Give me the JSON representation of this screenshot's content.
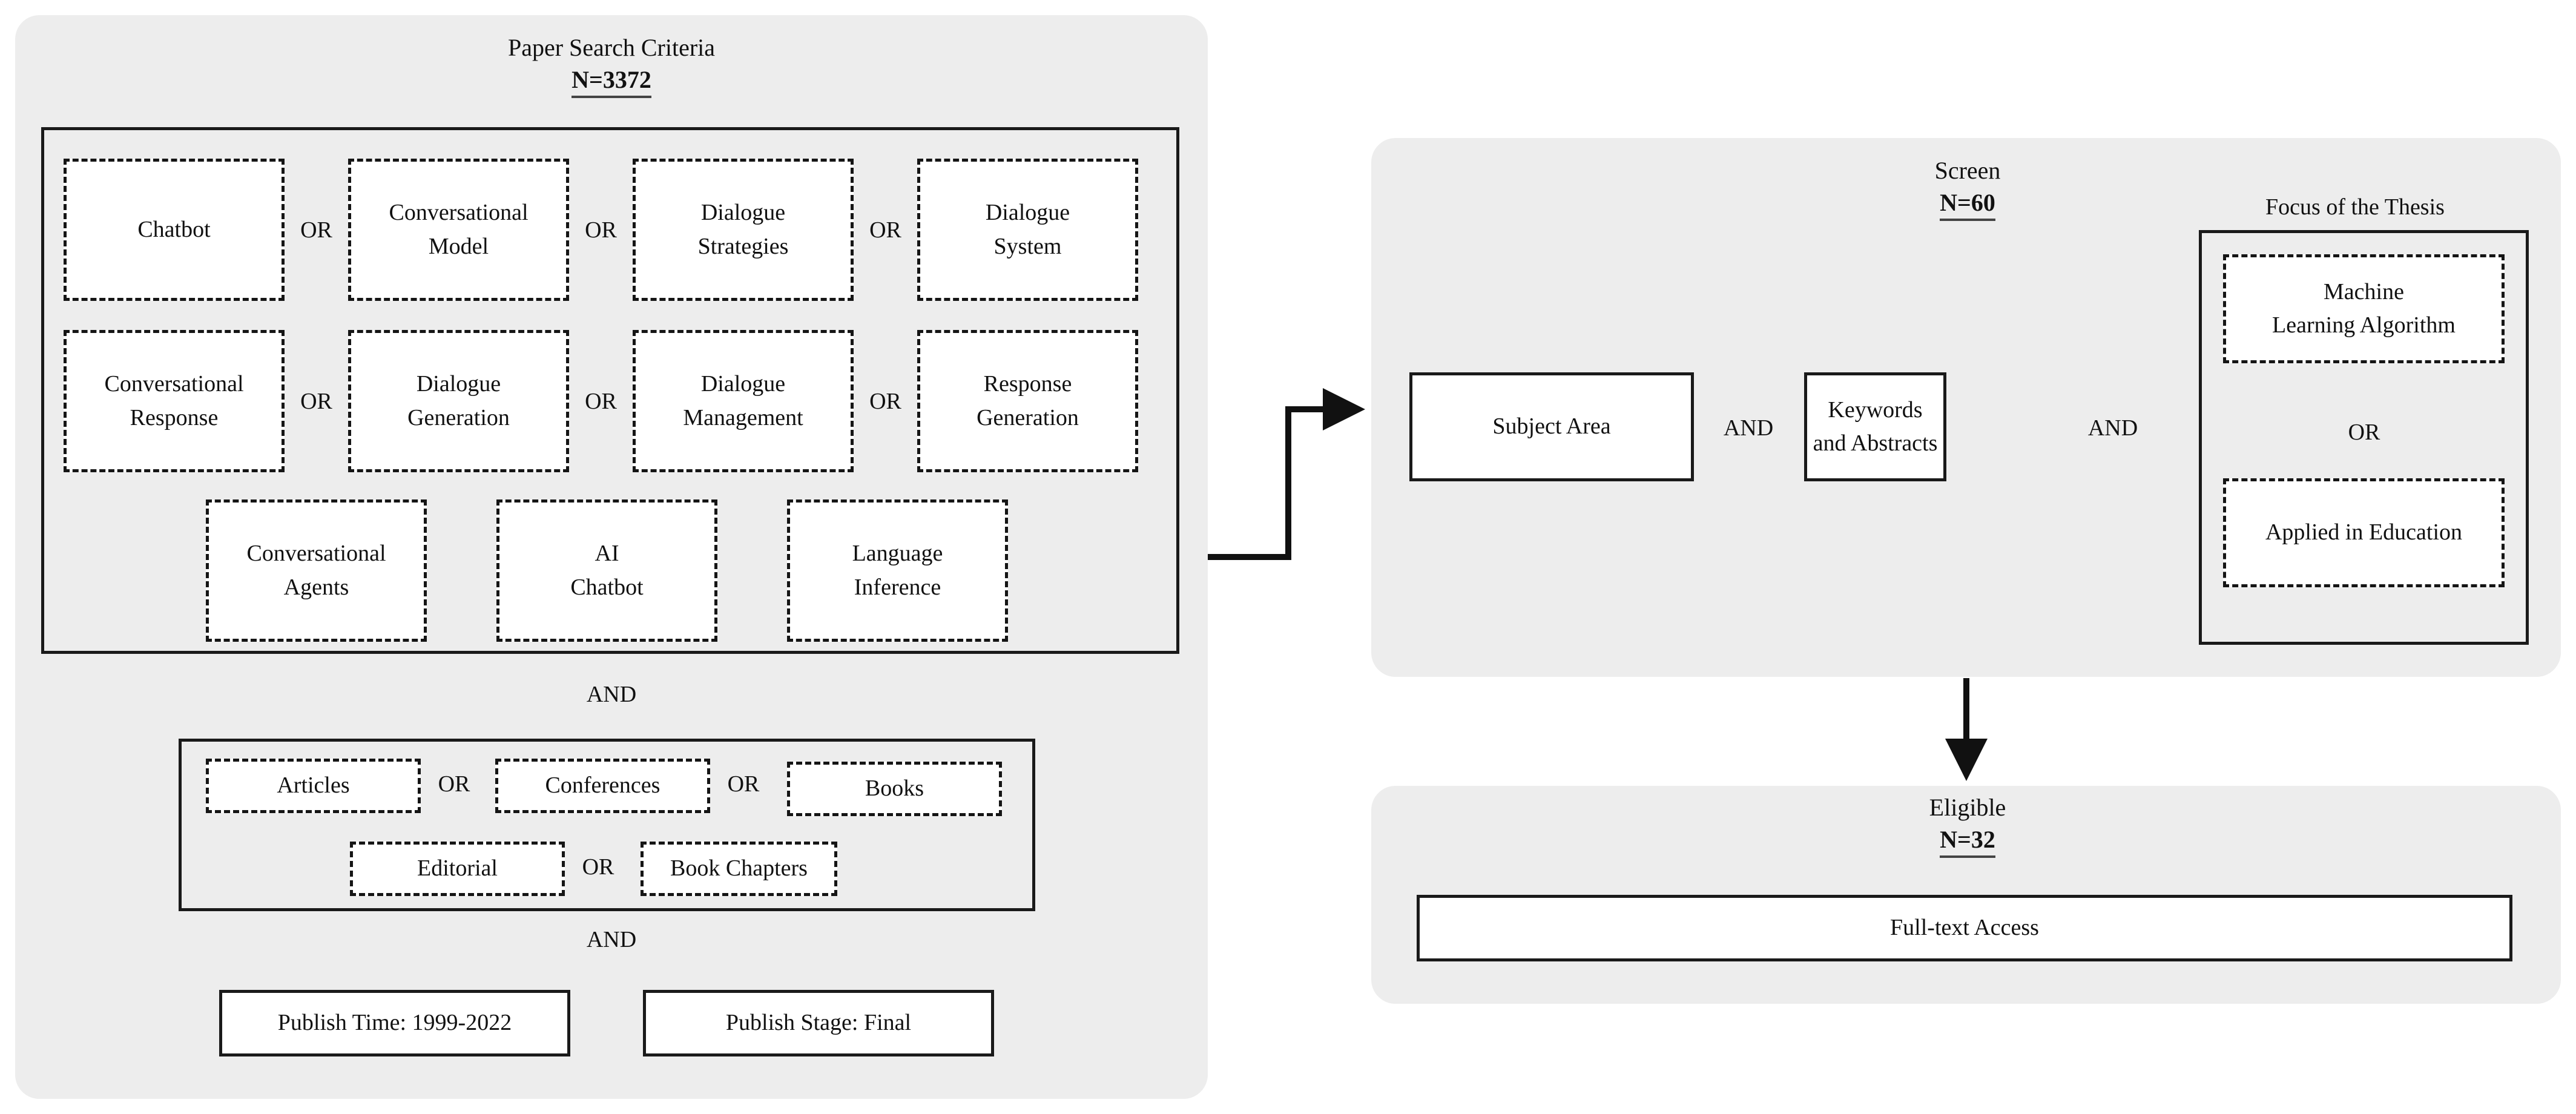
{
  "diagram": {
    "type": "prisma-style-search-flowchart",
    "background": "#ffffff",
    "panel_fill": "#ededed",
    "box_fill": "#ffffff",
    "stroke": "#1a1a1a"
  },
  "left_panel": {
    "title": "Paper Search Criteria",
    "count": "N=3372",
    "keyword_group": {
      "row1": [
        {
          "label": "Chatbot"
        },
        {
          "label_line1": "Conversational",
          "label_line2": "Model"
        },
        {
          "label_line1": "Dialogue",
          "label_line2": "Strategies"
        },
        {
          "label_line1": "Dialogue",
          "label_line2": "System"
        }
      ],
      "row1_ops": [
        "OR",
        "OR",
        "OR"
      ],
      "row2": [
        {
          "label_line1": "Conversational",
          "label_line2": "Response"
        },
        {
          "label_line1": "Dialogue",
          "label_line2": "Generation"
        },
        {
          "label_line1": "Dialogue",
          "label_line2": "Management"
        },
        {
          "label_line1": "Response",
          "label_line2": "Generation"
        }
      ],
      "row2_ops": [
        "OR",
        "OR",
        "OR"
      ],
      "row3": [
        {
          "label_line1": "Conversational",
          "label_line2": "Agents"
        },
        {
          "label_line1": "AI",
          "label_line2": "Chatbot"
        },
        {
          "label_line1": "Language",
          "label_line2": "Inference"
        }
      ]
    },
    "op_after_keywords": "AND",
    "doctype_group": {
      "row1": [
        {
          "label": "Articles"
        },
        {
          "label": "Conferences"
        },
        {
          "label": "Books"
        }
      ],
      "row1_ops": [
        "OR",
        "OR"
      ],
      "row2": [
        {
          "label": "Editorial"
        },
        {
          "label": "Book Chapters"
        }
      ],
      "row2_ops": [
        "OR"
      ]
    },
    "op_after_doctypes": "AND",
    "filters": [
      {
        "label": "Publish Time: 1999-2022"
      },
      {
        "label": "Publish Stage: Final"
      }
    ]
  },
  "screen_panel": {
    "title": "Screen",
    "count": "N=60",
    "focus_label": "Focus of the Thesis",
    "criteria": [
      {
        "label_line1": "Subject Area",
        "label_line2": ""
      },
      {
        "label_line1": "Keywords and",
        "label_line2": "Abstracts"
      }
    ],
    "ops": [
      "AND",
      "AND"
    ],
    "focus_group": {
      "options": [
        {
          "label_line1": "Machine",
          "label_line2": "Learning Algorithm"
        },
        {
          "label_line1": "Applied in Education",
          "label_line2": ""
        }
      ],
      "op": "OR"
    }
  },
  "eligible_panel": {
    "title": "Eligible",
    "count": "N=32",
    "box": {
      "label": "Full-text Access"
    }
  },
  "connectors": [
    {
      "name": "search-to-screen",
      "shape": "elbow-right-arrow"
    },
    {
      "name": "screen-to-eligible",
      "shape": "straight-down-arrow"
    }
  ]
}
